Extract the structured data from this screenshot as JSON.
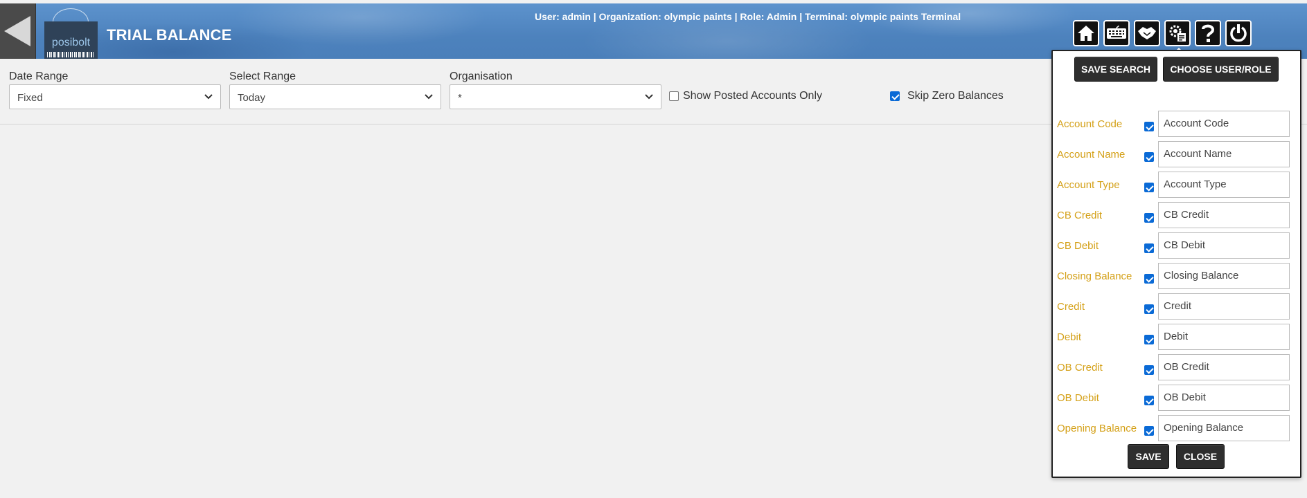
{
  "header": {
    "title": "TRIAL BALANCE",
    "logo_text": "posibolt",
    "user_info": "User: admin | Organization: olympic paints | Role: Admin | Terminal: olympic paints Terminal",
    "toolbar_icons": [
      "home-icon",
      "keyboard-icon",
      "handshake-icon",
      "settings-gear-icon",
      "help-icon",
      "power-icon"
    ]
  },
  "filters": {
    "date_range": {
      "label": "Date Range",
      "value": "Fixed"
    },
    "select_range": {
      "label": "Select Range",
      "value": "Today"
    },
    "organisation": {
      "label": "Organisation",
      "value": "*"
    },
    "show_posted": {
      "label": "Show Posted Accounts Only",
      "checked": false
    },
    "skip_zero": {
      "label": "Skip Zero Balances",
      "checked": true
    }
  },
  "popup": {
    "save_search_label": "SAVE SEARCH",
    "choose_user_role_label": "CHOOSE USER/ROLE",
    "columns": [
      {
        "label": "Account Code",
        "value": "Account Code",
        "checked": true
      },
      {
        "label": "Account Name",
        "value": "Account Name",
        "checked": true
      },
      {
        "label": "Account Type",
        "value": "Account Type",
        "checked": true
      },
      {
        "label": "CB Credit",
        "value": "CB Credit",
        "checked": true
      },
      {
        "label": "CB Debit",
        "value": "CB Debit",
        "checked": true
      },
      {
        "label": "Closing Balance",
        "value": "Closing Balance",
        "checked": true
      },
      {
        "label": "Credit",
        "value": "Credit",
        "checked": true
      },
      {
        "label": "Debit",
        "value": "Debit",
        "checked": true
      },
      {
        "label": "OB Credit",
        "value": "OB Credit",
        "checked": true
      },
      {
        "label": "OB Debit",
        "value": "OB Debit",
        "checked": true
      },
      {
        "label": "Opening Balance",
        "value": "Opening Balance",
        "checked": true
      }
    ],
    "save_label": "SAVE",
    "close_label": "CLOSE"
  },
  "colors": {
    "header_blue": "#4d82bd",
    "column_label": "#d4a017",
    "checkbox_blue": "#0a6ad6",
    "dark_button": "#2e2e2e"
  }
}
